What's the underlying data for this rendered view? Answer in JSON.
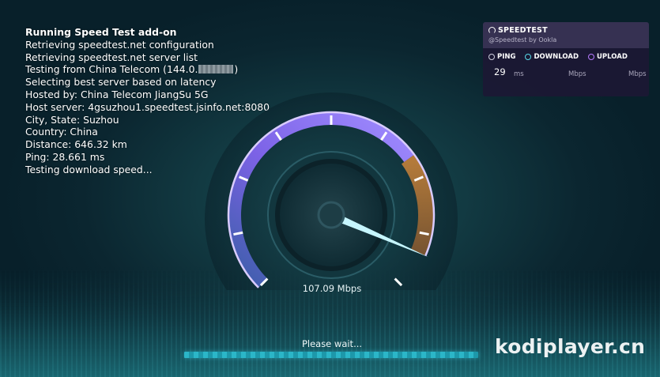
{
  "log": {
    "title": "Running Speed Test add-on",
    "lines": [
      "Retrieving speedtest.net configuration",
      "Retrieving speedtest.net server list",
      "Testing from China Telecom (144.0.",
      "Selecting best server based on latency",
      "Hosted by: China Telecom JiangSu 5G",
      "Host server: 4gsuzhou1.speedtest.jsinfo.net:8080",
      "City, State: Suzhou",
      "Country: China",
      "Distance: 646.32 km",
      "Ping: 28.661 ms",
      "Testing download speed..."
    ],
    "testing_from_suffix": ")"
  },
  "panel": {
    "brand": "SPEEDTEST",
    "subtitle": "@Speedtest by Ookla",
    "ping_label": "PING",
    "download_label": "DOWNLOAD",
    "upload_label": "UPLOAD",
    "ping_value": "29",
    "ping_unit": "ms",
    "download_unit": "Mbps",
    "upload_unit": "Mbps"
  },
  "gauge": {
    "speed_text": "107.09 Mbps",
    "fill_fraction": 0.92
  },
  "status": {
    "wait_text": "Please wait..."
  },
  "watermark": "kodiplayer.cn",
  "colors": {
    "arc_purple": "#8a6cff",
    "arc_blue": "#3b5ea8",
    "arc_orange": "#d2883a",
    "needle": "#bff6ff",
    "progress": "#2bb6c8"
  }
}
